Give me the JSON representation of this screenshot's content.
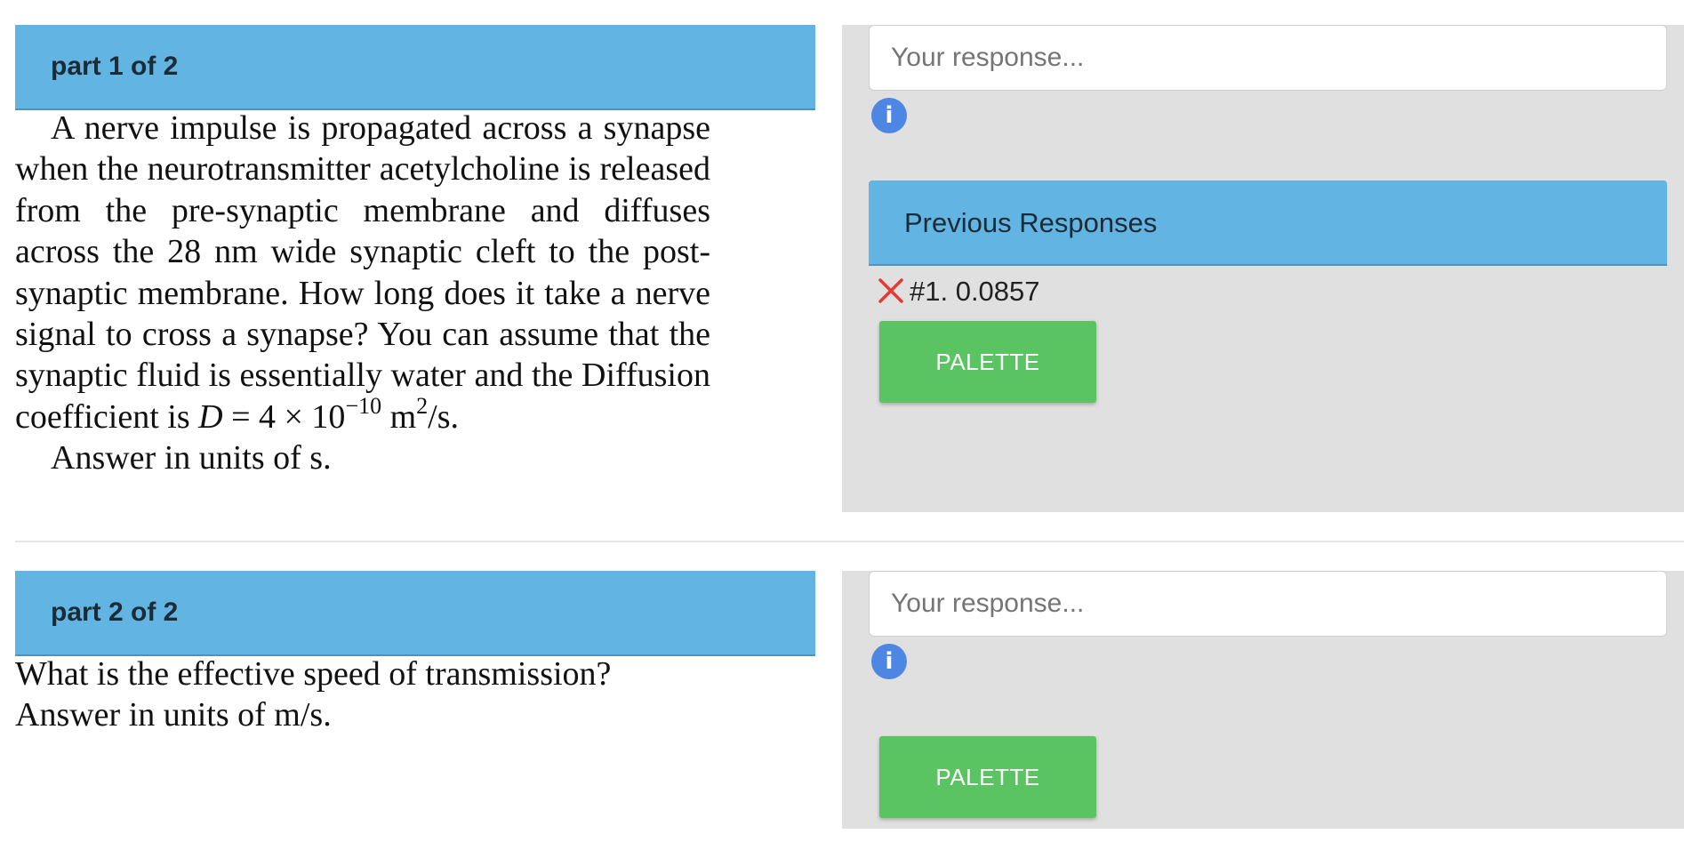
{
  "part1": {
    "title": "part 1 of 2",
    "q1": "A nerve impulse is propagated across a synapse when the neurotransmitter acetyl­choline is released from the pre-synaptic mem­brane and diffuses across the 28 nm wide synaptic cleft to the post-synaptic membrane. How long does it take a nerve signal to cross a synapse? You can assume that the synap­tic fluid is essentially water and the Diffusion coefficient is ",
    "d_var": "D",
    "d_eq": " = 4 × 10",
    "d_exp": "−10",
    "d_unit": " m",
    "d_unit_exp": "2",
    "d_unit_tail": "/s.",
    "answer_units": "Answer in units of  s.",
    "response_placeholder": "Your response...",
    "info_glyph": "i",
    "previous_responses": {
      "title": "Previous Responses",
      "items": [
        {
          "label": "#1. 0.0857",
          "status_icon": "x-icon",
          "status": "incorrect",
          "status_color": "#e53935"
        }
      ]
    },
    "palette_label": "PALETTE"
  },
  "part2": {
    "title": "part 2 of 2",
    "question": "What is the effective speed of transmission?",
    "answer_units": "Answer in units of  m/s.",
    "response_placeholder": "Your response...",
    "info_glyph": "i",
    "palette_label": "PALETTE"
  },
  "colors": {
    "header_blue": "#62b5e3",
    "palette_green": "#5bc462",
    "info_blue": "#4e86e4",
    "panel_gray": "#e0e0e0"
  }
}
